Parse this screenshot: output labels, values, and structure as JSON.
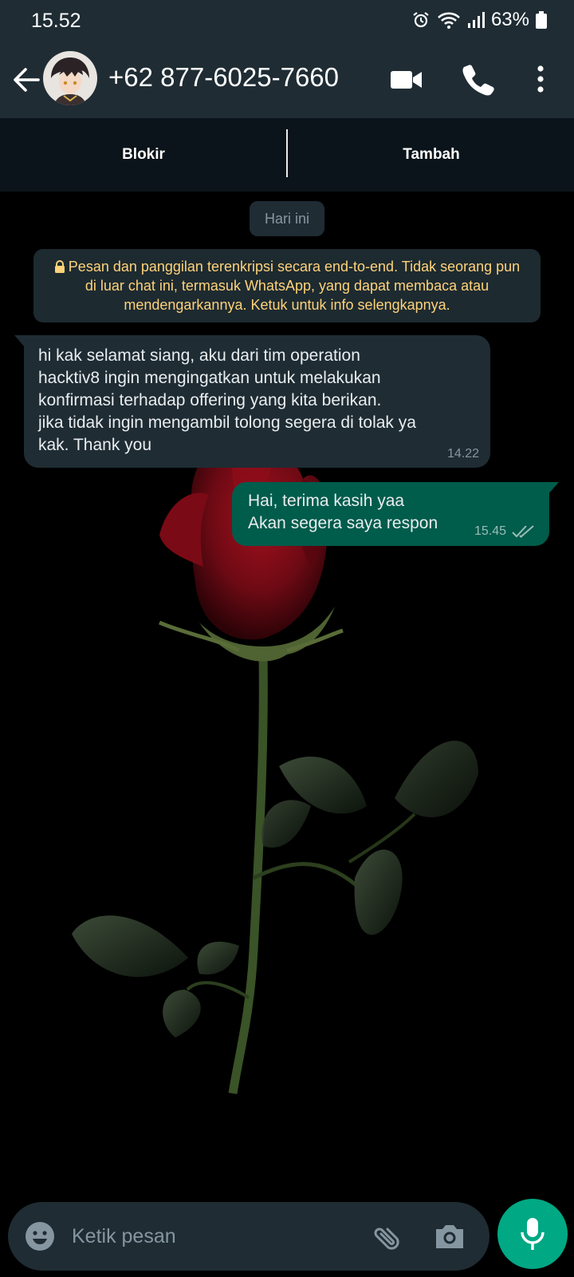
{
  "status_bar": {
    "time": "15.52",
    "battery": "63%",
    "icons": [
      "alarm-icon",
      "wifi-icon",
      "signal-icon",
      "battery-icon"
    ]
  },
  "header": {
    "contact_name": "+62 877-6025-7660",
    "icons": [
      "back-arrow-icon",
      "video-call-icon",
      "voice-call-icon",
      "more-options-icon"
    ]
  },
  "action_bar": {
    "block_label": "Blokir",
    "add_label": "Tambah"
  },
  "chat": {
    "date_chip": "Hari ini",
    "encryption_notice": "Pesan dan panggilan terenkripsi secara end-to-end. Tidak seorang pun di luar chat ini, termasuk WhatsApp, yang dapat membaca atau mendengarkannya. Ketuk untuk info selengkapnya.",
    "messages": [
      {
        "direction": "incoming",
        "text": "hi kak selamat siang, aku dari tim operation\nhacktiv8 ingin mengingatkan untuk melakukan\nkonfirmasi terhadap offering yang kita berikan.\njika tidak ingin mengambil tolong segera di tolak ya\nkak. Thank you",
        "time": "14.22"
      },
      {
        "direction": "outgoing",
        "text": "Hai, terima kasih yaa\nAkan segera saya respon",
        "time": "15.45",
        "status": "read"
      }
    ],
    "wallpaper": "red-rose-on-black"
  },
  "composer": {
    "placeholder": "Ketik pesan",
    "icons": [
      "emoji-icon",
      "attach-icon",
      "camera-icon",
      "mic-icon"
    ]
  },
  "colors": {
    "header_bg": "#1f2c34",
    "outgoing_bubble": "#005c4b",
    "incoming_bubble": "#1f2c34",
    "accent": "#00a884",
    "notice_text": "#ffd279"
  }
}
